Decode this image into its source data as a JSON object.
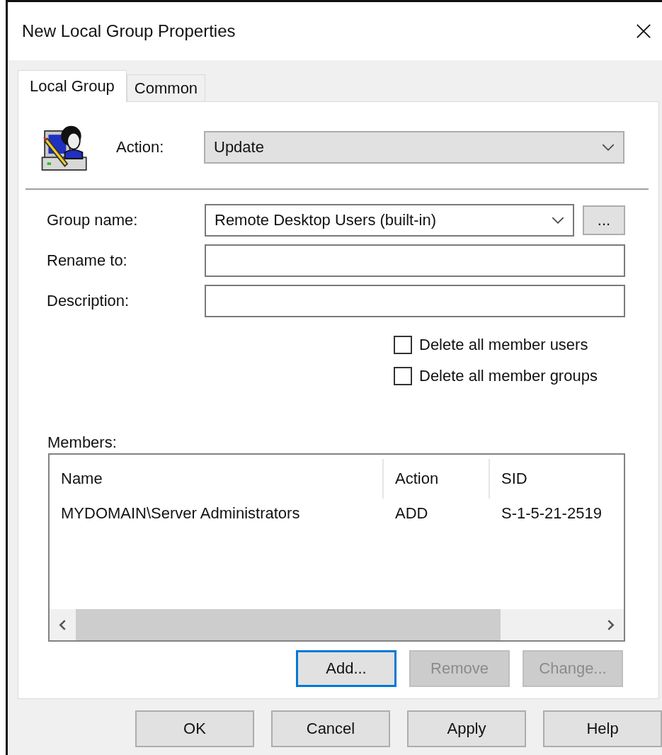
{
  "window": {
    "title": "New Local Group Properties"
  },
  "tabs": [
    {
      "label": "Local Group",
      "selected": true
    },
    {
      "label": "Common",
      "selected": false
    }
  ],
  "action": {
    "label": "Action:",
    "value": "Update"
  },
  "fields": [
    {
      "label": "Group name:",
      "kind": "dropdown",
      "value": "Remote Desktop Users (built-in)",
      "browse": "..."
    },
    {
      "label": "Rename to:",
      "kind": "text"
    },
    {
      "label": "Description:",
      "kind": "text"
    }
  ],
  "checkboxes": [
    {
      "label": "Delete all member users",
      "checked": false
    },
    {
      "label": "Delete all member groups",
      "checked": false
    }
  ],
  "members": {
    "label": "Members:",
    "columns": [
      "Name",
      "Action",
      "SID"
    ],
    "rows": [
      [
        "MYDOMAIN\\Server Administrators",
        "ADD",
        "S-1-5-21-2519"
      ]
    ]
  },
  "member_buttons": [
    {
      "label": "Add...",
      "disabled": false,
      "focused": true
    },
    {
      "label": "Remove",
      "disabled": true,
      "focused": false
    },
    {
      "label": "Change...",
      "disabled": true,
      "focused": false
    }
  ],
  "dialog_buttons": [
    {
      "label": "OK"
    },
    {
      "label": "Cancel"
    },
    {
      "label": "Apply"
    },
    {
      "label": "Help"
    }
  ]
}
